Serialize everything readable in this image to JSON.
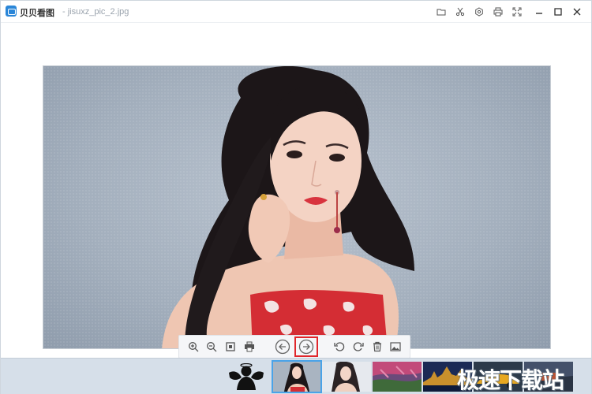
{
  "titlebar": {
    "app_name": "贝贝看图",
    "file_name": "- jisuxz_pic_2.jpg",
    "icons": [
      "folder-icon",
      "scissors-icon",
      "settings-icon",
      "print-icon",
      "fullscreen-icon",
      "minimize-icon",
      "maximize-icon",
      "close-icon"
    ]
  },
  "toolbar": {
    "buttons": [
      "zoom-in-icon",
      "zoom-out-icon",
      "fit-icon",
      "print-icon",
      "previous-icon",
      "next-icon",
      "rotate-left-icon",
      "rotate-right-icon",
      "delete-icon",
      "wallpaper-icon"
    ],
    "highlighted": "next-icon"
  },
  "filmstrip": {
    "watermark": "极速下载站",
    "selected_index": 0
  },
  "colors": {
    "accent": "#2a86d8",
    "highlight": "#e0262b",
    "filmstrip_bg": "#d6dfe9"
  }
}
